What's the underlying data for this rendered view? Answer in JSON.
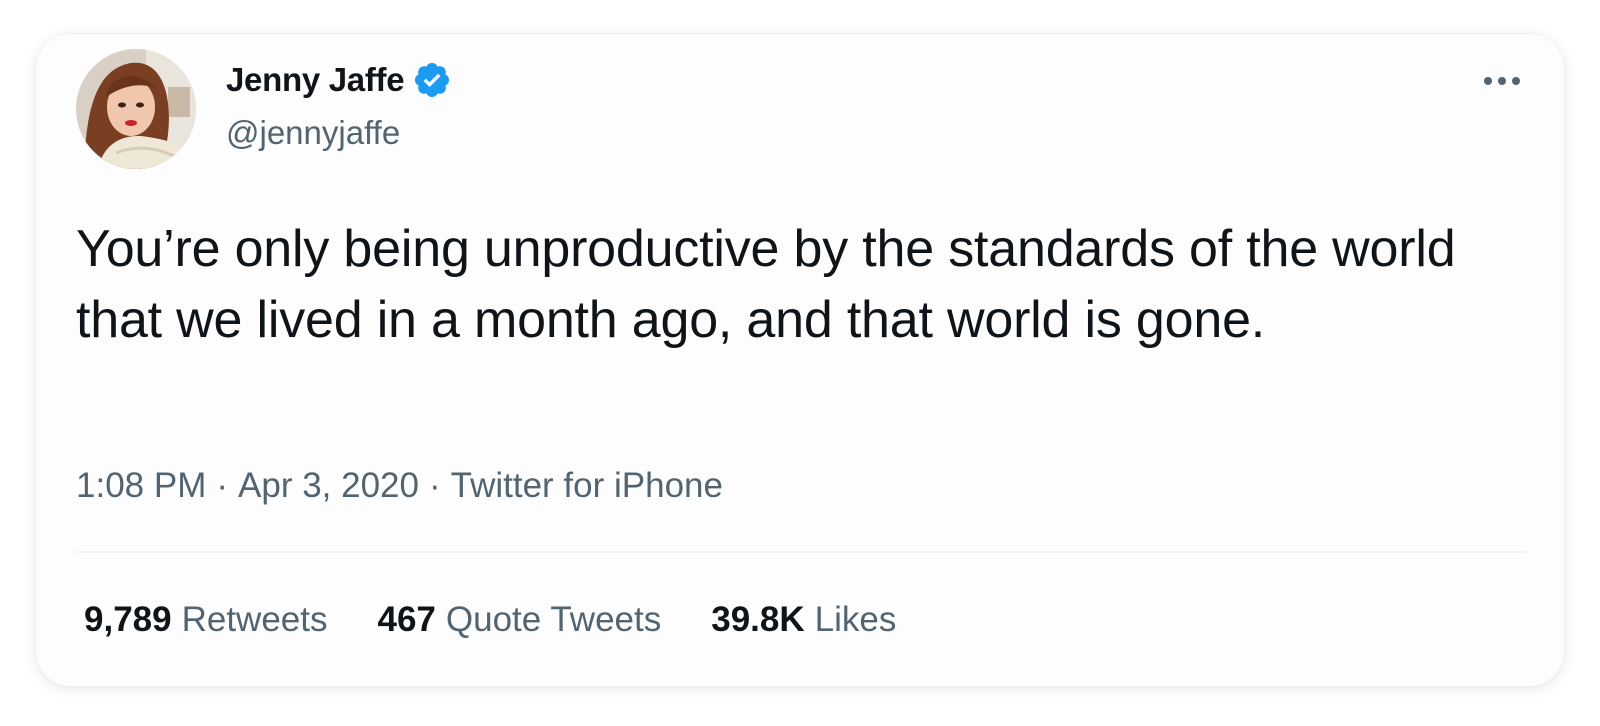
{
  "colors": {
    "text_primary": "#0f1419",
    "text_secondary": "#536471",
    "verified_blue": "#1d9bf0",
    "divider": "#eff3f4"
  },
  "author": {
    "display_name": "Jenny Jaffe",
    "handle": "@jennyjaffe",
    "verified_icon": "verified-badge-icon",
    "avatar": "profile-photo"
  },
  "tweet": {
    "text": "You’re only being unproductive by the standards of the world that we lived in a month ago, and that world is gone."
  },
  "meta": {
    "time": "1:08 PM",
    "separator": "·",
    "date": "Apr 3, 2020",
    "source": "Twitter for iPhone"
  },
  "stats": [
    {
      "count": "9,789",
      "label": "Retweets"
    },
    {
      "count": "467",
      "label": "Quote Tweets"
    },
    {
      "count": "39.8K",
      "label": "Likes"
    }
  ],
  "menu_icon": "more-horizontal-icon"
}
